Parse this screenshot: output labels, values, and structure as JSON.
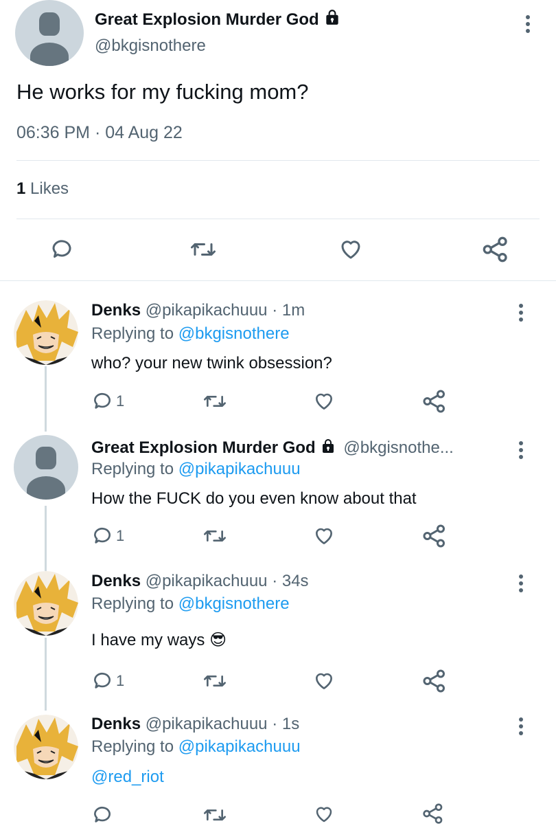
{
  "main_tweet": {
    "display_name": "Great Explosion Murder God",
    "handle": "@bkgisnothere",
    "text": "He works for my fucking mom?",
    "timestamp": "06:36 PM · 04 Aug 22",
    "likes_count": "1",
    "likes_label": "Likes"
  },
  "replies": [
    {
      "display_name": "Denks",
      "handle": "@pikapikachuuu",
      "time": "· 1m",
      "replying_prefix": "Replying to",
      "replying_to": "@bkgisnothere",
      "text": "who? your new twink obsession?",
      "reply_count": "1"
    },
    {
      "display_name": "Great Explosion Murder God",
      "handle": "@bkgisnothe...",
      "time": "",
      "replying_prefix": "Replying to",
      "replying_to": "@pikapikachuuu",
      "text": "How the FUCK do you even know about that",
      "reply_count": "1"
    },
    {
      "display_name": "Denks",
      "handle": "@pikapikachuuu",
      "time": "· 34s",
      "replying_prefix": "Replying to",
      "replying_to": "@bkgisnothere",
      "text": "I have my ways",
      "emoji": "😎",
      "reply_count": "1"
    },
    {
      "display_name": "Denks",
      "handle": "@pikapikachuuu",
      "time": "· 1s",
      "replying_prefix": "Replying to",
      "replying_to": "@pikapikachuuu",
      "mention": "@red_riot",
      "reply_count": ""
    }
  ],
  "colors": {
    "link": "#1d9bf0",
    "muted": "#536471",
    "text": "#0f1419",
    "divider": "#e1e8ed"
  },
  "icons": [
    "lock-icon",
    "more-options-icon",
    "reply-icon",
    "retweet-icon",
    "like-icon",
    "share-icon"
  ]
}
